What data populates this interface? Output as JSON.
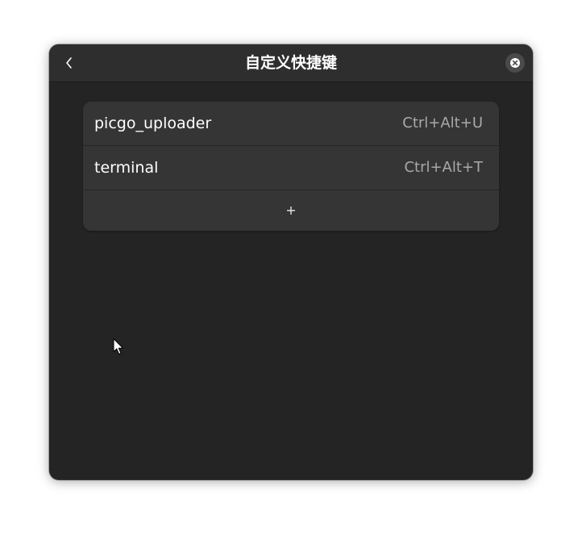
{
  "window": {
    "title": "自定义快捷键"
  },
  "icons": {
    "back": "chevron-left-icon",
    "close": "close-icon",
    "add": "plus-icon"
  },
  "shortcuts": [
    {
      "name": "picgo_uploader",
      "accelerator": "Ctrl+Alt+U"
    },
    {
      "name": "terminal",
      "accelerator": "Ctrl+Alt+T"
    }
  ],
  "colors": {
    "window_bg": "#242424",
    "header_bg": "#2e2e2e",
    "list_bg": "#353535",
    "text": "#ffffff",
    "dim_text": "#a9a9a9"
  }
}
